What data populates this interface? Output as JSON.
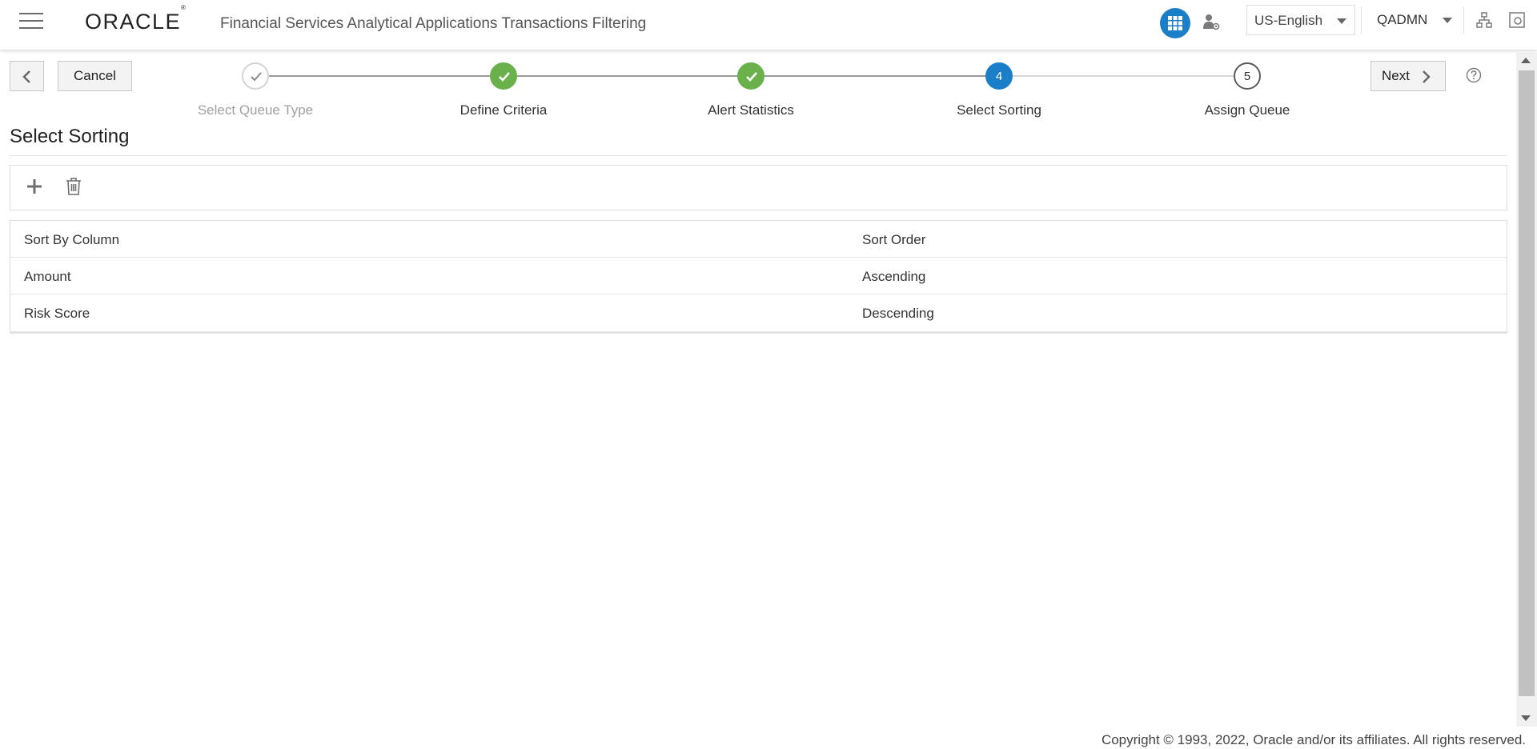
{
  "header": {
    "logo": "ORACLE",
    "logo_mark": "®",
    "app_title": "Financial Services Analytical Applications Transactions Filtering",
    "language": "US-English",
    "user": "QADMN",
    "icons": [
      "hamburger-menu-icon",
      "apps-grid-icon",
      "user-settings-icon",
      "chevron-down-icon",
      "sitemap-icon",
      "window-icon"
    ],
    "accent_color": "#1b7ec8"
  },
  "wizard": {
    "cancel_label": "Cancel",
    "next_label": "Next",
    "steps": [
      {
        "label": "Select Queue Type",
        "state": "visited",
        "marker": ""
      },
      {
        "label": "Define Criteria",
        "state": "complete",
        "marker": ""
      },
      {
        "label": "Alert Statistics",
        "state": "complete",
        "marker": ""
      },
      {
        "label": "Select Sorting",
        "state": "current",
        "marker": "4"
      },
      {
        "label": "Assign Queue",
        "state": "pending",
        "marker": "5"
      }
    ],
    "complete_color": "#6ab14c",
    "current_color": "#1b7ec8"
  },
  "page": {
    "title": "Select Sorting"
  },
  "toolbar": {
    "add_icon": "plus-icon",
    "delete_icon": "trash-icon"
  },
  "grid": {
    "columns": [
      "Sort By Column",
      "Sort Order"
    ],
    "rows": [
      [
        "Amount",
        "Ascending"
      ],
      [
        "Risk Score",
        "Descending"
      ]
    ]
  },
  "footer": {
    "copyright": "Copyright © 1993, 2022, Oracle and/or its affiliates. All rights reserved."
  }
}
